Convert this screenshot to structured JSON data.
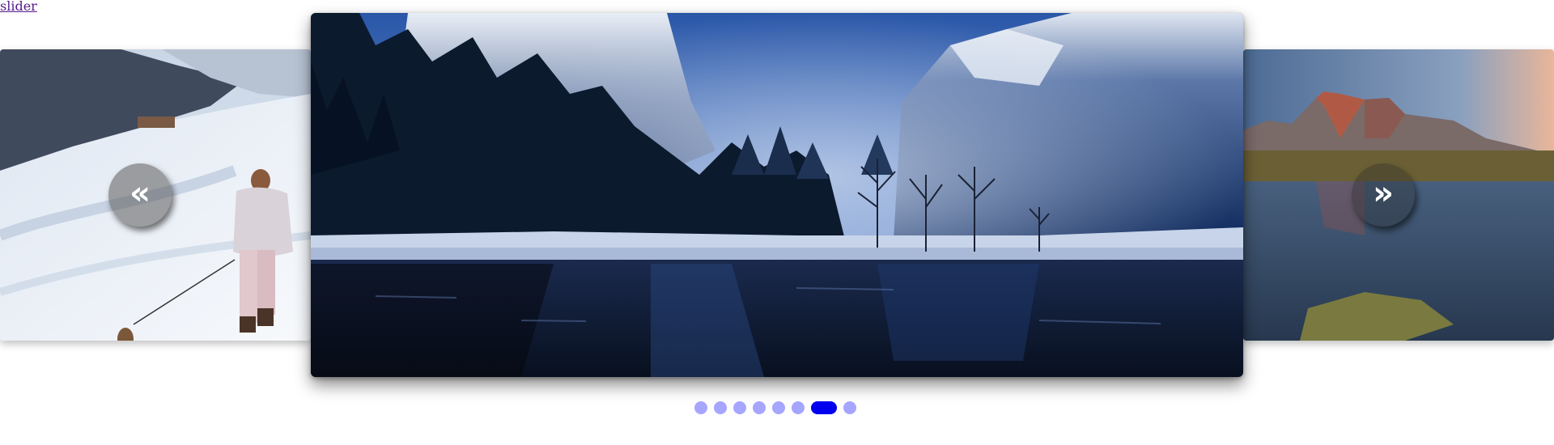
{
  "header": {
    "link_text": "slider"
  },
  "slider": {
    "prev_glyph": "«",
    "next_glyph": "»",
    "slides": [
      {
        "name": "winter-walk-with-dog",
        "icon": "winter-walk-image"
      },
      {
        "name": "blue-valley-river",
        "icon": "river-landscape-image"
      },
      {
        "name": "mountain-lake-sunset",
        "icon": "mountain-lake-image"
      }
    ],
    "dot_count": 8,
    "active_index": 6,
    "colors": {
      "dot": "#a6a6ff",
      "dot_active": "#0000ee",
      "link": "#551a8b"
    }
  }
}
